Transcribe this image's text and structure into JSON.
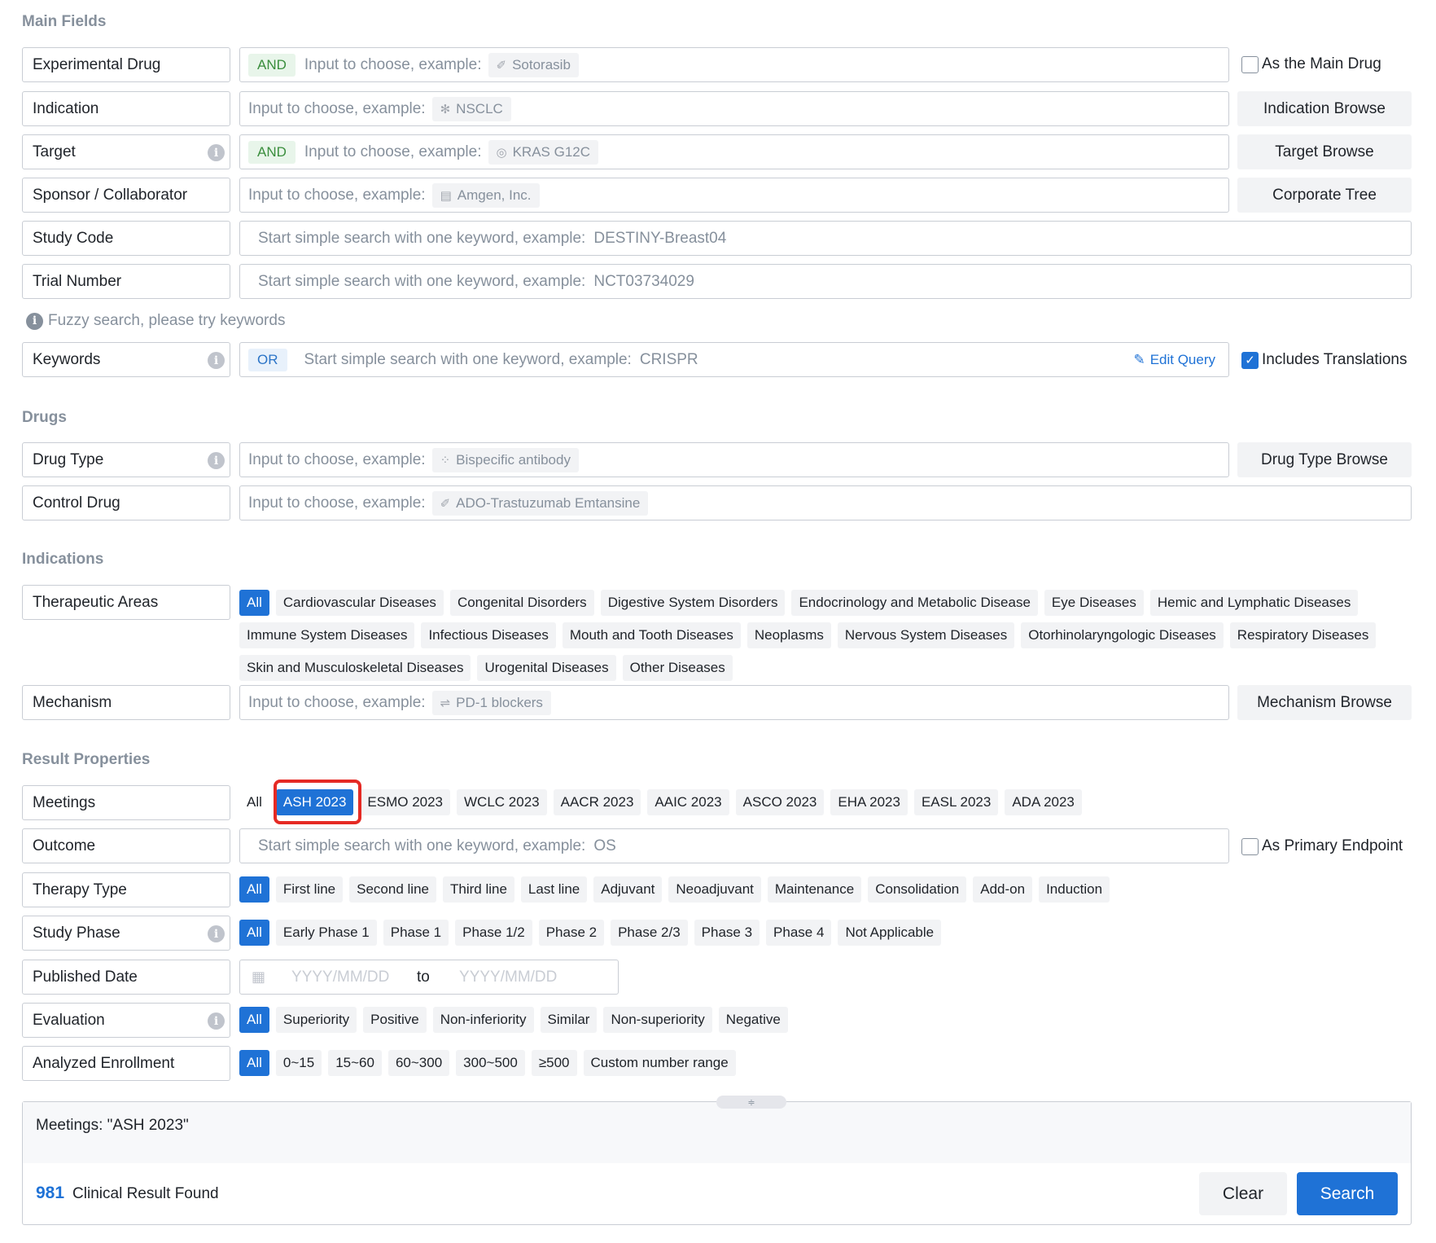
{
  "sections": {
    "main": "Main Fields",
    "drugs": "Drugs",
    "indications": "Indications",
    "results": "Result Properties"
  },
  "main": {
    "experimental_drug": {
      "label": "Experimental Drug",
      "op": "AND",
      "placeholder": "Input to choose, example:",
      "example": "Sotorasib",
      "check_label": "As the Main Drug"
    },
    "indication": {
      "label": "Indication",
      "placeholder": "Input to choose, example:",
      "example": "NSCLC",
      "button": "Indication Browse"
    },
    "target": {
      "label": "Target",
      "op": "AND",
      "placeholder": "Input to choose, example:",
      "example": "KRAS G12C",
      "button": "Target Browse"
    },
    "sponsor": {
      "label": "Sponsor / Collaborator",
      "placeholder": "Input to choose, example:",
      "example": "Amgen, Inc.",
      "button": "Corporate Tree"
    },
    "study_code": {
      "label": "Study Code",
      "placeholder": "Start simple search with one keyword, example:",
      "example": "DESTINY-Breast04"
    },
    "trial_number": {
      "label": "Trial Number",
      "placeholder": "Start simple search with one keyword, example:",
      "example": "NCT03734029"
    },
    "fuzzy_hint": "Fuzzy search, please try keywords",
    "keywords": {
      "label": "Keywords",
      "op": "OR",
      "placeholder": "Start simple search with one keyword, example:",
      "example": "CRISPR",
      "edit": "Edit Query",
      "check_label": "Includes Translations"
    }
  },
  "drugs": {
    "drug_type": {
      "label": "Drug Type",
      "placeholder": "Input to choose, example:",
      "example": "Bispecific antibody",
      "button": "Drug Type Browse"
    },
    "control_drug": {
      "label": "Control Drug",
      "placeholder": "Input to choose, example:",
      "example": "ADO-Trastuzumab Emtansine"
    }
  },
  "indications": {
    "therapeutic_areas": {
      "label": "Therapeutic Areas",
      "options": [
        "All",
        "Cardiovascular Diseases",
        "Congenital Disorders",
        "Digestive System Disorders",
        "Endocrinology and Metabolic Disease",
        "Eye Diseases",
        "Hemic and Lymphatic Diseases",
        "Immune System Diseases",
        "Infectious Diseases",
        "Mouth and Tooth Diseases",
        "Neoplasms",
        "Nervous System Diseases",
        "Otorhinolaryngologic Diseases",
        "Respiratory Diseases",
        "Skin and Musculoskeletal Diseases",
        "Urogenital Diseases",
        "Other Diseases"
      ]
    },
    "mechanism": {
      "label": "Mechanism",
      "placeholder": "Input to choose, example:",
      "example": "PD-1 blockers",
      "button": "Mechanism Browse"
    }
  },
  "results": {
    "meetings": {
      "label": "Meetings",
      "options": [
        "All",
        "ASH 2023",
        "ESMO 2023",
        "WCLC 2023",
        "AACR 2023",
        "AAIC 2023",
        "ASCO 2023",
        "EHA 2023",
        "EASL 2023",
        "ADA 2023"
      ]
    },
    "outcome": {
      "label": "Outcome",
      "placeholder": "Start simple search with one keyword, example:",
      "example": "OS",
      "check_label": "As Primary Endpoint"
    },
    "therapy_type": {
      "label": "Therapy Type",
      "options": [
        "All",
        "First line",
        "Second line",
        "Third line",
        "Last line",
        "Adjuvant",
        "Neoadjuvant",
        "Maintenance",
        "Consolidation",
        "Add-on",
        "Induction"
      ]
    },
    "study_phase": {
      "label": "Study Phase",
      "options": [
        "All",
        "Early Phase 1",
        "Phase 1",
        "Phase 1/2",
        "Phase 2",
        "Phase 2/3",
        "Phase 3",
        "Phase 4",
        "Not Applicable"
      ]
    },
    "published_date": {
      "label": "Published Date",
      "from_placeholder": "YYYY/MM/DD",
      "to": "to",
      "to_placeholder": "YYYY/MM/DD"
    },
    "evaluation": {
      "label": "Evaluation",
      "options": [
        "All",
        "Superiority",
        "Positive",
        "Non-inferiority",
        "Similar",
        "Non-superiority",
        "Negative"
      ]
    },
    "analyzed_enrollment": {
      "label": "Analyzed Enrollment",
      "options": [
        "All",
        "0~15",
        "15~60",
        "60~300",
        "300~500",
        "≥500",
        "Custom number range"
      ]
    }
  },
  "summary": {
    "query": "Meetings: \"ASH 2023\"",
    "count": "981",
    "count_label": "Clinical Result Found",
    "clear": "Clear",
    "search": "Search"
  },
  "colors": {
    "accent": "#1f72d6",
    "highlight": "#e52a24"
  }
}
